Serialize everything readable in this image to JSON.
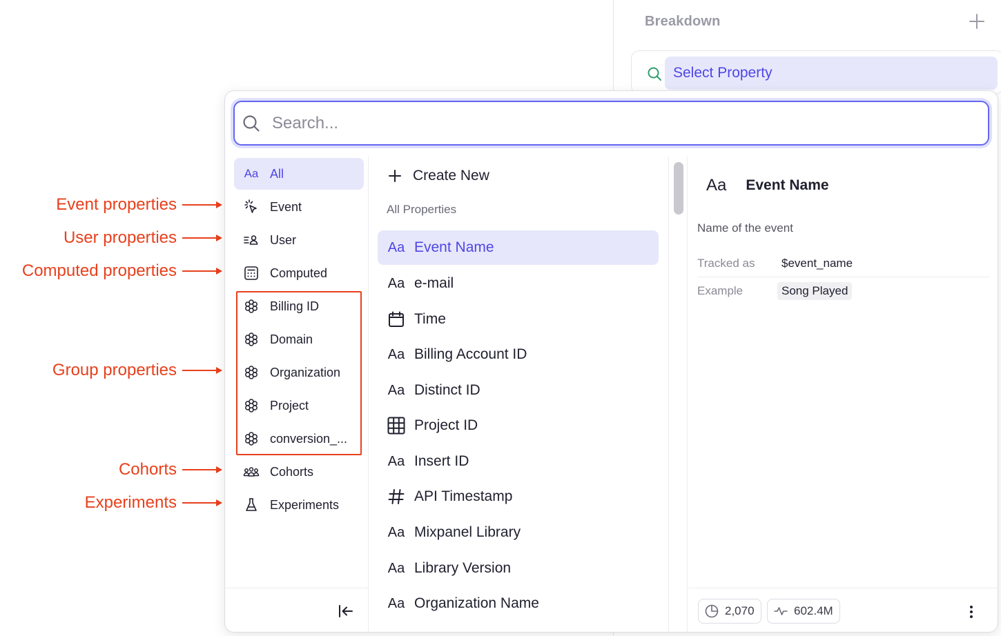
{
  "breakdown": {
    "title": "Breakdown",
    "select_property": "Select Property"
  },
  "search": {
    "placeholder": "Search..."
  },
  "categories": [
    {
      "label": "All",
      "icon": "aa-icon",
      "active": true
    },
    {
      "label": "Event",
      "icon": "cursor-click-icon"
    },
    {
      "label": "User",
      "icon": "user-list-icon"
    },
    {
      "label": "Computed",
      "icon": "calculator-icon"
    },
    {
      "label": "Billing ID",
      "icon": "group-icon"
    },
    {
      "label": "Domain",
      "icon": "group-icon"
    },
    {
      "label": "Organization",
      "icon": "group-icon"
    },
    {
      "label": "Project",
      "icon": "group-icon"
    },
    {
      "label": "conversion_...",
      "icon": "group-icon"
    },
    {
      "label": "Cohorts",
      "icon": "cohorts-icon"
    },
    {
      "label": "Experiments",
      "icon": "flask-icon"
    }
  ],
  "annotations": {
    "event": "Event properties",
    "user": "User properties",
    "computed": "Computed properties",
    "group": "Group properties",
    "cohorts": "Cohorts",
    "experiments": "Experiments"
  },
  "list": {
    "create_new": "Create New",
    "section_title": "All Properties",
    "items": [
      {
        "label": "Event Name",
        "icon": "aa-icon",
        "active": true
      },
      {
        "label": "e-mail",
        "icon": "aa-icon"
      },
      {
        "label": "Time",
        "icon": "calendar-icon"
      },
      {
        "label": "Billing Account ID",
        "icon": "aa-icon"
      },
      {
        "label": "Distinct ID",
        "icon": "aa-icon"
      },
      {
        "label": "Project ID",
        "icon": "grid-icon"
      },
      {
        "label": "Insert ID",
        "icon": "aa-icon"
      },
      {
        "label": "API Timestamp",
        "icon": "hash-icon"
      },
      {
        "label": "Mixpanel Library",
        "icon": "aa-icon"
      },
      {
        "label": "Library Version",
        "icon": "aa-icon"
      },
      {
        "label": "Organization Name",
        "icon": "aa-icon"
      }
    ]
  },
  "detail": {
    "icon_text": "Aa",
    "title": "Event Name",
    "description": "Name of the event",
    "tracked_as_label": "Tracked as",
    "tracked_as_value": "$event_name",
    "example_label": "Example",
    "example_value": "Song Played",
    "stat_count": "2,070",
    "stat_volume": "602.4M"
  },
  "glyphs": {
    "aa": "Aa"
  },
  "colors": {
    "accent": "#4f46e5",
    "accent_bg": "#e7e7fb",
    "annotation": "#e8401c"
  }
}
